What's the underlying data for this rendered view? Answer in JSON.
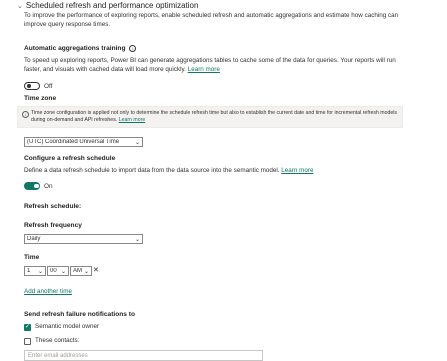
{
  "section": {
    "title": "Scheduled refresh and performance optimization",
    "description": "To improve the performance of exploring reports, enable scheduled refresh and automatic aggregations and estimate how caching can improve query response times."
  },
  "aggregations": {
    "label": "Automatic aggregations training",
    "description": "To speed up exploring reports, Power BI can generate aggregations tables to cache some of the data for queries. Your reports will run faster, and visuals with cached data will load more quickly.",
    "learn_more": "Learn more",
    "toggle_state": "Off"
  },
  "timezone": {
    "label": "Time zone",
    "info": "Time zone configuration is applied not only to determine the schedule refresh time but also to establish the current date and time for incremental refresh models during on-demand and API refreshes.",
    "info_link": "Learn more",
    "selected": "(UTC) Coordinated Universal Time"
  },
  "refresh_schedule": {
    "label": "Configure a refresh schedule",
    "description": "Define a data refresh schedule to import data from the data source into the semantic model.",
    "learn_more": "Learn more",
    "toggle_state": "On",
    "schedule_heading": "Refresh schedule:",
    "frequency_label": "Refresh frequency",
    "frequency_value": "Daily",
    "time_label": "Time",
    "hour": "1",
    "minute": "00",
    "ampm": "AM",
    "remove_glyph": "✕",
    "add_time": "Add another time"
  },
  "notifications": {
    "label": "Send refresh failure notifications to",
    "owner_option": "Semantic model owner",
    "owner_checked": true,
    "contacts_option": "These contacts:",
    "contacts_checked": false,
    "email_placeholder": "Enter email addresses"
  },
  "colors": {
    "accent": "#117865",
    "text": "#252423",
    "info_bg": "#f3f2f1"
  }
}
